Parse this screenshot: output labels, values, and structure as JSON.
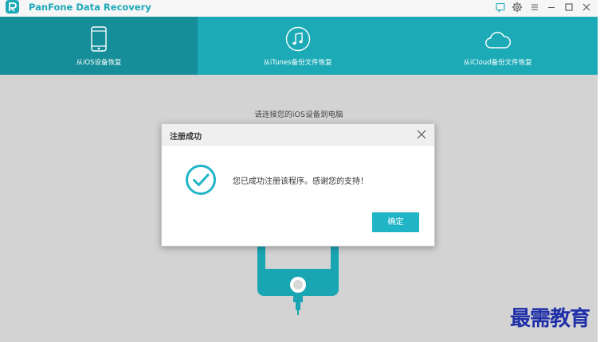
{
  "app": {
    "title": "PanFone Data Recovery",
    "accent_color": "#1baab6"
  },
  "window_controls": [
    {
      "name": "feedback-icon"
    },
    {
      "name": "settings-gear-icon"
    },
    {
      "name": "menu-icon"
    },
    {
      "name": "minimize-icon"
    },
    {
      "name": "maximize-icon"
    },
    {
      "name": "close-icon"
    }
  ],
  "nav": {
    "tabs": [
      {
        "label": "从iOS设备恢复",
        "icon": "phone-icon",
        "active": true
      },
      {
        "label": "从iTunes备份文件恢复",
        "icon": "music-note-icon",
        "active": false
      },
      {
        "label": "从iCloud备份文件恢复",
        "icon": "cloud-icon",
        "active": false
      }
    ]
  },
  "main": {
    "connect_hint": "请连接您的iOS设备到电脑"
  },
  "dialog": {
    "title": "注册成功",
    "message": "您已成功注册该程序。感谢您的支持！",
    "ok_label": "确定",
    "success_color": "#1fb5c7"
  },
  "watermark": {
    "text": "最需教育"
  }
}
